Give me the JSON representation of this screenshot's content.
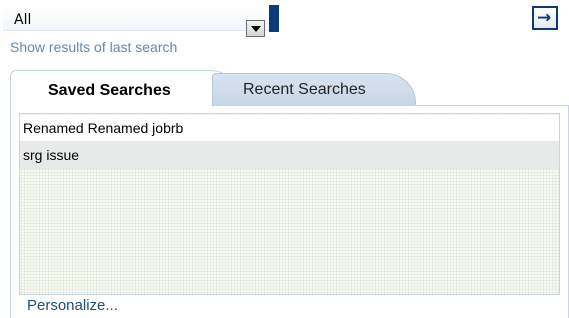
{
  "search_scope": {
    "selected": "All"
  },
  "go_button": {
    "symbol": "→"
  },
  "show_results_link": "Show results of last search",
  "tabs": [
    {
      "label": "Saved Searches",
      "active": true
    },
    {
      "label": "Recent Searches",
      "active": false
    }
  ],
  "saved_searches": [
    {
      "label": "Renamed Renamed jobrb"
    },
    {
      "label": "srg issue"
    }
  ],
  "personalize_link": "Personalize...",
  "colors": {
    "accent": "#0b3a7a",
    "link": "#1f4d79",
    "tab_inactive": "#c7d6e4",
    "selected_row": "#e8eaea"
  },
  "icons": {
    "dropdown": "chevron-down-icon",
    "go": "arrow-right-icon"
  }
}
